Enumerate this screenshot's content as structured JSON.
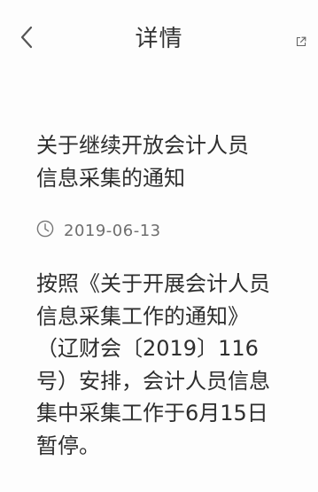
{
  "header": {
    "title": "详情",
    "back_icon": "chevron-left-icon",
    "share_icon": "share-external-icon"
  },
  "article": {
    "title_lines": [
      "关于继续开放会计人员",
      "信息采集的通知"
    ],
    "date_icon": "clock-icon",
    "date": "2019-06-13",
    "body_lines": [
      "按照《关于开展会计人员",
      "信息采集工作的通知》",
      "（辽财会〔2019〕116",
      "号）安排，会计人员信息",
      "集中采集工作于6月15日",
      "暂停。"
    ]
  },
  "colors": {
    "background": "#fdfdfd",
    "text": "#2e2e2e",
    "muted": "#6e6e6e",
    "icon": "#555555"
  }
}
